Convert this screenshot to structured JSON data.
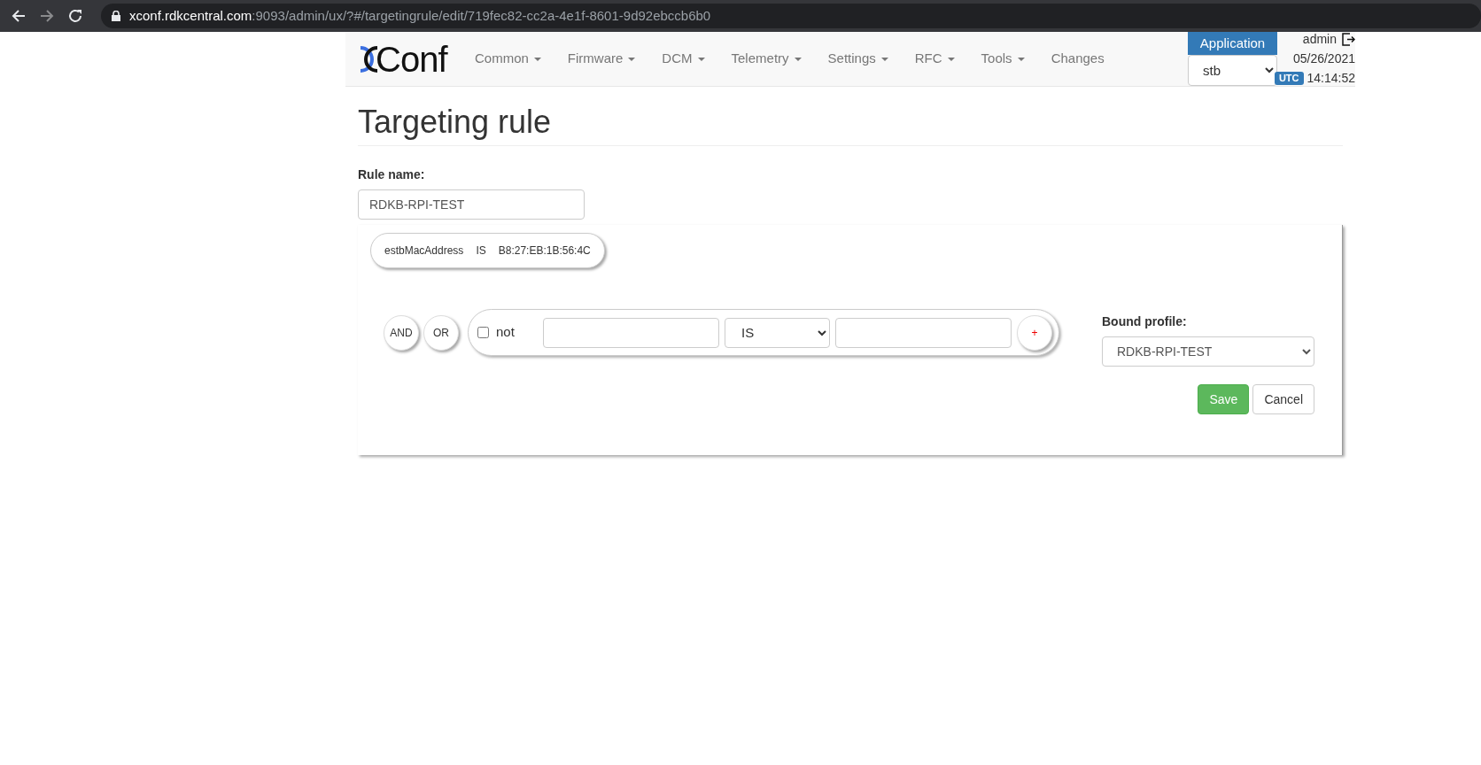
{
  "browser": {
    "url_host": "xconf.rdkcentral.com",
    "url_path": ":9093/admin/ux/?#/targetingrule/edit/719fec82-cc2a-4e1f-8601-9d92ebccb6b0"
  },
  "nav": {
    "logo": "Conf",
    "items": [
      {
        "label": "Common",
        "dropdown": true
      },
      {
        "label": "Firmware",
        "dropdown": true
      },
      {
        "label": "DCM",
        "dropdown": true
      },
      {
        "label": "Telemetry",
        "dropdown": true
      },
      {
        "label": "Settings",
        "dropdown": true
      },
      {
        "label": "RFC",
        "dropdown": true
      },
      {
        "label": "Tools",
        "dropdown": true
      },
      {
        "label": "Changes",
        "dropdown": false
      }
    ]
  },
  "application": {
    "label": "Application",
    "value": "stb"
  },
  "user": {
    "name": "admin",
    "date": "05/26/2021",
    "timezone": "UTC",
    "time": "14:14:52"
  },
  "title": "Targeting rule",
  "rule_name": {
    "label": "Rule name:",
    "value": "RDKB-RPI-TEST"
  },
  "conditions": [
    {
      "field": "estbMacAddress",
      "operator": "IS",
      "value": "B8:27:EB:1B:56:4C"
    }
  ],
  "builder": {
    "and": "AND",
    "or": "OR",
    "not_label": "not",
    "not_checked": false,
    "operator": "IS",
    "add": "+"
  },
  "bound_profile": {
    "label": "Bound profile:",
    "value": "RDKB-RPI-TEST"
  },
  "buttons": {
    "save": "Save",
    "cancel": "Cancel"
  }
}
